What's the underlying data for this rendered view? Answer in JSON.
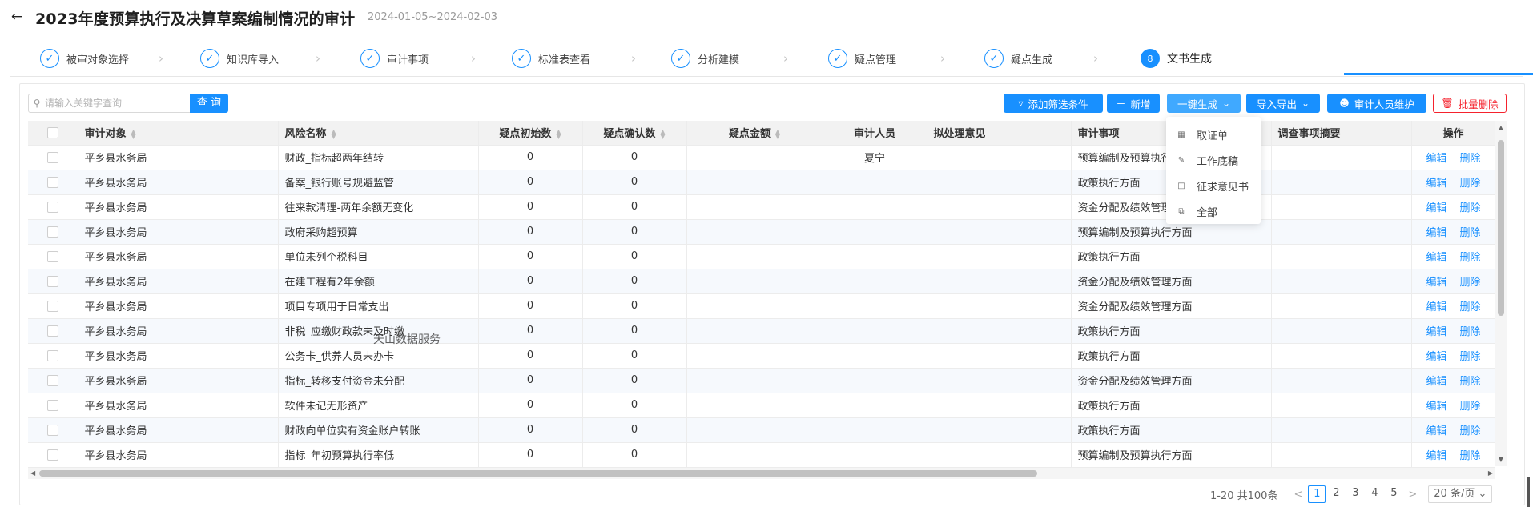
{
  "header": {
    "back_icon": "arrow-left-icon",
    "title": "2023年度预算执行及决算草案编制情况的审计",
    "date_range": "2024-01-05~2024-02-03"
  },
  "steps": [
    {
      "label": "被审对象选择",
      "state": "done"
    },
    {
      "label": "知识库导入",
      "state": "done"
    },
    {
      "label": "审计事项",
      "state": "done"
    },
    {
      "label": "标准表查看",
      "state": "done"
    },
    {
      "label": "分析建模",
      "state": "done"
    },
    {
      "label": "疑点管理",
      "state": "done"
    },
    {
      "label": "疑点生成",
      "state": "done"
    },
    {
      "label": "文书生成",
      "state": "active",
      "number": "8"
    }
  ],
  "toolbar": {
    "search_placeholder": "请输入关键字查询",
    "search_button": "查 询",
    "add_filter": "添加筛选条件",
    "add_new": "新增",
    "one_click_generate": "一键生成",
    "import_export": "导入导出",
    "auditor_maintain": "审计人员维护",
    "batch_delete": "批量删除"
  },
  "dropdown": [
    {
      "label": "取证单",
      "icon": "doc-icon"
    },
    {
      "label": "工作底稿",
      "icon": "edit-doc-icon"
    },
    {
      "label": "征求意见书",
      "icon": "file-icon"
    },
    {
      "label": "全部",
      "icon": "copy-icon"
    }
  ],
  "table": {
    "headers": {
      "target": "审计对象",
      "risk": "风险名称",
      "init_count": "疑点初始数",
      "confirm_count": "疑点确认数",
      "amount": "疑点金额",
      "auditor": "审计人员",
      "opinion": "拟处理意见",
      "matter": "审计事项",
      "summary": "调查事项摘要",
      "ops": "操作"
    },
    "rows": [
      {
        "target": "平乡县水务局",
        "risk": "财政_指标超两年结转",
        "init": "0",
        "confirm": "0",
        "amount": "",
        "auditor": "夏宁",
        "opinion": "",
        "matter": "预算编制及预算执行方面",
        "summary": ""
      },
      {
        "target": "平乡县水务局",
        "risk": "备案_银行账号规避监管",
        "init": "0",
        "confirm": "0",
        "amount": "",
        "auditor": "",
        "opinion": "",
        "matter": "政策执行方面",
        "summary": ""
      },
      {
        "target": "平乡县水务局",
        "risk": "往来款清理-两年余额无变化",
        "init": "0",
        "confirm": "0",
        "amount": "",
        "auditor": "",
        "opinion": "",
        "matter": "资金分配及绩效管理方面",
        "summary": ""
      },
      {
        "target": "平乡县水务局",
        "risk": "政府采购超预算",
        "init": "0",
        "confirm": "0",
        "amount": "",
        "auditor": "",
        "opinion": "",
        "matter": "预算编制及预算执行方面",
        "summary": ""
      },
      {
        "target": "平乡县水务局",
        "risk": "单位未列个税科目",
        "init": "0",
        "confirm": "0",
        "amount": "",
        "auditor": "",
        "opinion": "",
        "matter": "政策执行方面",
        "summary": ""
      },
      {
        "target": "平乡县水务局",
        "risk": "在建工程有2年余额",
        "init": "0",
        "confirm": "0",
        "amount": "",
        "auditor": "",
        "opinion": "",
        "matter": "资金分配及绩效管理方面",
        "summary": ""
      },
      {
        "target": "平乡县水务局",
        "risk": "项目专项用于日常支出",
        "init": "0",
        "confirm": "0",
        "amount": "",
        "auditor": "",
        "opinion": "",
        "matter": "资金分配及绩效管理方面",
        "summary": ""
      },
      {
        "target": "平乡县水务局",
        "risk": "非税_应缴财政款未及时缴",
        "init": "0",
        "confirm": "0",
        "amount": "",
        "auditor": "",
        "opinion": "",
        "matter": "政策执行方面",
        "summary": ""
      },
      {
        "target": "平乡县水务局",
        "risk": "公务卡_供养人员未办卡",
        "init": "0",
        "confirm": "0",
        "amount": "",
        "auditor": "",
        "opinion": "",
        "matter": "政策执行方面",
        "summary": ""
      },
      {
        "target": "平乡县水务局",
        "risk": "指标_转移支付资金未分配",
        "init": "0",
        "confirm": "0",
        "amount": "",
        "auditor": "",
        "opinion": "",
        "matter": "资金分配及绩效管理方面",
        "summary": ""
      },
      {
        "target": "平乡县水务局",
        "risk": "软件未记无形资产",
        "init": "0",
        "confirm": "0",
        "amount": "",
        "auditor": "",
        "opinion": "",
        "matter": "政策执行方面",
        "summary": ""
      },
      {
        "target": "平乡县水务局",
        "risk": "财政向单位实有资金账户转账",
        "init": "0",
        "confirm": "0",
        "amount": "",
        "auditor": "",
        "opinion": "",
        "matter": "政策执行方面",
        "summary": ""
      },
      {
        "target": "平乡县水务局",
        "risk": "指标_年初预算执行率低",
        "init": "0",
        "confirm": "0",
        "amount": "",
        "auditor": "",
        "opinion": "",
        "matter": "预算编制及预算执行方面",
        "summary": ""
      }
    ],
    "edit_label": "编辑",
    "delete_label": "删除"
  },
  "watermark": "天山数据服务",
  "pagination": {
    "total": "1-20 共100条",
    "pages": [
      "1",
      "2",
      "3",
      "4",
      "5"
    ],
    "current": "1",
    "page_size": "20 条/页"
  },
  "colors": {
    "primary": "#1890ff",
    "danger": "#f5222d"
  }
}
